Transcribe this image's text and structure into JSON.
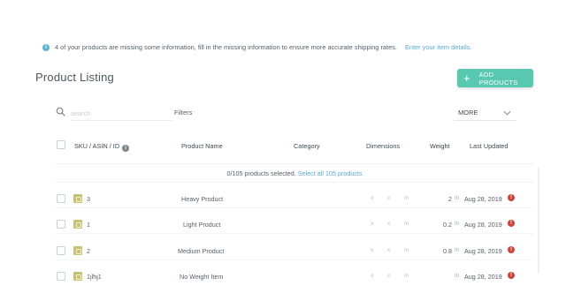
{
  "notice": {
    "text": "4 of your products are missing some information, fill in the missing information to ensure more accurate shipping rates.",
    "link": "Enter your item details."
  },
  "page_title": "Product Listing",
  "add_button": {
    "label": "ADD PRODUCTS"
  },
  "toolbar": {
    "search_placeholder": "search",
    "filters_label": "Filters",
    "more_label": "MORE"
  },
  "table": {
    "headers": {
      "sku": "SKU / ASIN / ID",
      "name": "Product Name",
      "category": "Category",
      "dimensions": "Dimensions",
      "weight": "Weight",
      "updated": "Last Updated"
    },
    "selection": {
      "count": "0/105 products selected.",
      "select_all": "Select all 105 products"
    },
    "rows": [
      {
        "sku": "3",
        "name": "Heavy Product",
        "dims": [
          "x",
          "x",
          "in"
        ],
        "weight": "2",
        "unit": "lb",
        "updated": "Aug 28, 2019"
      },
      {
        "sku": "1",
        "name": "Light Product",
        "dims": [
          "x",
          "x",
          "in"
        ],
        "weight": "0.2",
        "unit": "lb",
        "updated": "Aug 28, 2019"
      },
      {
        "sku": "2",
        "name": "Medium Product",
        "dims": [
          "x",
          "x",
          "in"
        ],
        "weight": "0.8",
        "unit": "lb",
        "updated": "Aug 28, 2019"
      },
      {
        "sku": "1jlhj1",
        "name": "No Weight Item",
        "dims": [
          "x",
          "x",
          "in"
        ],
        "weight": "",
        "unit": "lb",
        "updated": "Aug 28, 2019"
      }
    ]
  },
  "colors": {
    "accent": "#58c8b1",
    "link": "#5aa9d6",
    "alert": "#c9443a",
    "info": "#5fb3d1"
  },
  "icons": {
    "notice": "info-icon",
    "add": "plus-icon",
    "search": "search-icon",
    "more": "chevron-down-icon",
    "row_type": "box-icon",
    "row_status": "alert-icon"
  }
}
